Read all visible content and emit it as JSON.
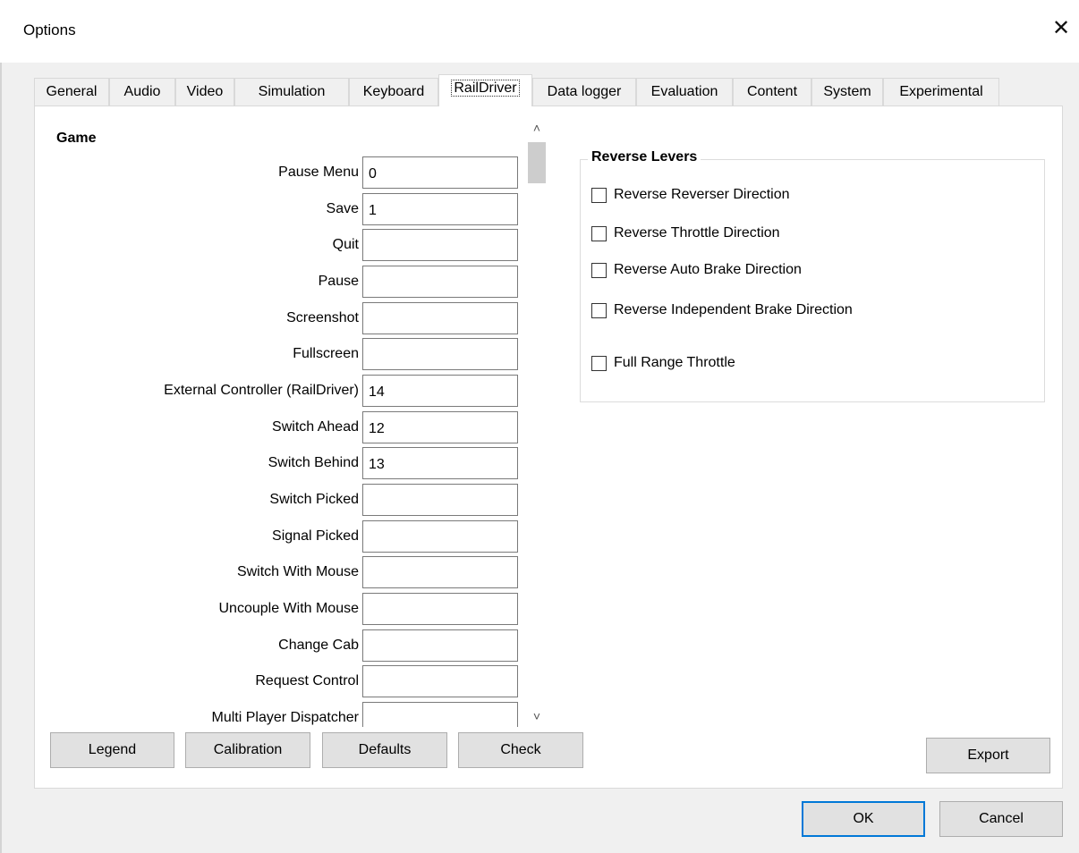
{
  "window": {
    "title": "Options",
    "close_glyph": "✕"
  },
  "tabs": [
    {
      "label": "General"
    },
    {
      "label": "Audio"
    },
    {
      "label": "Video"
    },
    {
      "label": "Simulation"
    },
    {
      "label": "Keyboard"
    },
    {
      "label": "RailDriver",
      "active": true
    },
    {
      "label": "Data logger"
    },
    {
      "label": "Evaluation"
    },
    {
      "label": "Content"
    },
    {
      "label": "System"
    },
    {
      "label": "Experimental"
    }
  ],
  "game_section": {
    "title": "Game",
    "rows": [
      {
        "label": "Pause Menu",
        "value": "0"
      },
      {
        "label": "Save",
        "value": "1"
      },
      {
        "label": "Quit",
        "value": ""
      },
      {
        "label": "Pause",
        "value": ""
      },
      {
        "label": "Screenshot",
        "value": ""
      },
      {
        "label": "Fullscreen",
        "value": ""
      },
      {
        "label": "External Controller (RailDriver)",
        "value": "14"
      },
      {
        "label": "Switch Ahead",
        "value": "12"
      },
      {
        "label": "Switch Behind",
        "value": "13"
      },
      {
        "label": "Switch Picked",
        "value": ""
      },
      {
        "label": "Signal Picked",
        "value": ""
      },
      {
        "label": "Switch With Mouse",
        "value": ""
      },
      {
        "label": "Uncouple With Mouse",
        "value": ""
      },
      {
        "label": "Change Cab",
        "value": ""
      },
      {
        "label": "Request Control",
        "value": ""
      },
      {
        "label": "Multi Player Dispatcher",
        "value": ""
      }
    ]
  },
  "scrollbar": {
    "up_glyph": "˄",
    "down_glyph": "˅"
  },
  "reverse_levers": {
    "title": "Reverse Levers",
    "options": [
      {
        "label": "Reverse Reverser Direction",
        "checked": false
      },
      {
        "label": "Reverse Throttle Direction",
        "checked": false
      },
      {
        "label": "Reverse Auto Brake Direction",
        "checked": false
      },
      {
        "label": "Reverse Independent Brake Direction",
        "checked": false
      },
      {
        "label": "Full Range Throttle",
        "checked": false
      }
    ]
  },
  "buttons": {
    "legend": "Legend",
    "calibration": "Calibration",
    "defaults": "Defaults",
    "check": "Check",
    "export": "Export",
    "ok": "OK",
    "cancel": "Cancel"
  },
  "colors": {
    "accent": "#0078d7",
    "button_face": "#e1e1e1",
    "dialog_bg": "#f0f0f0"
  }
}
